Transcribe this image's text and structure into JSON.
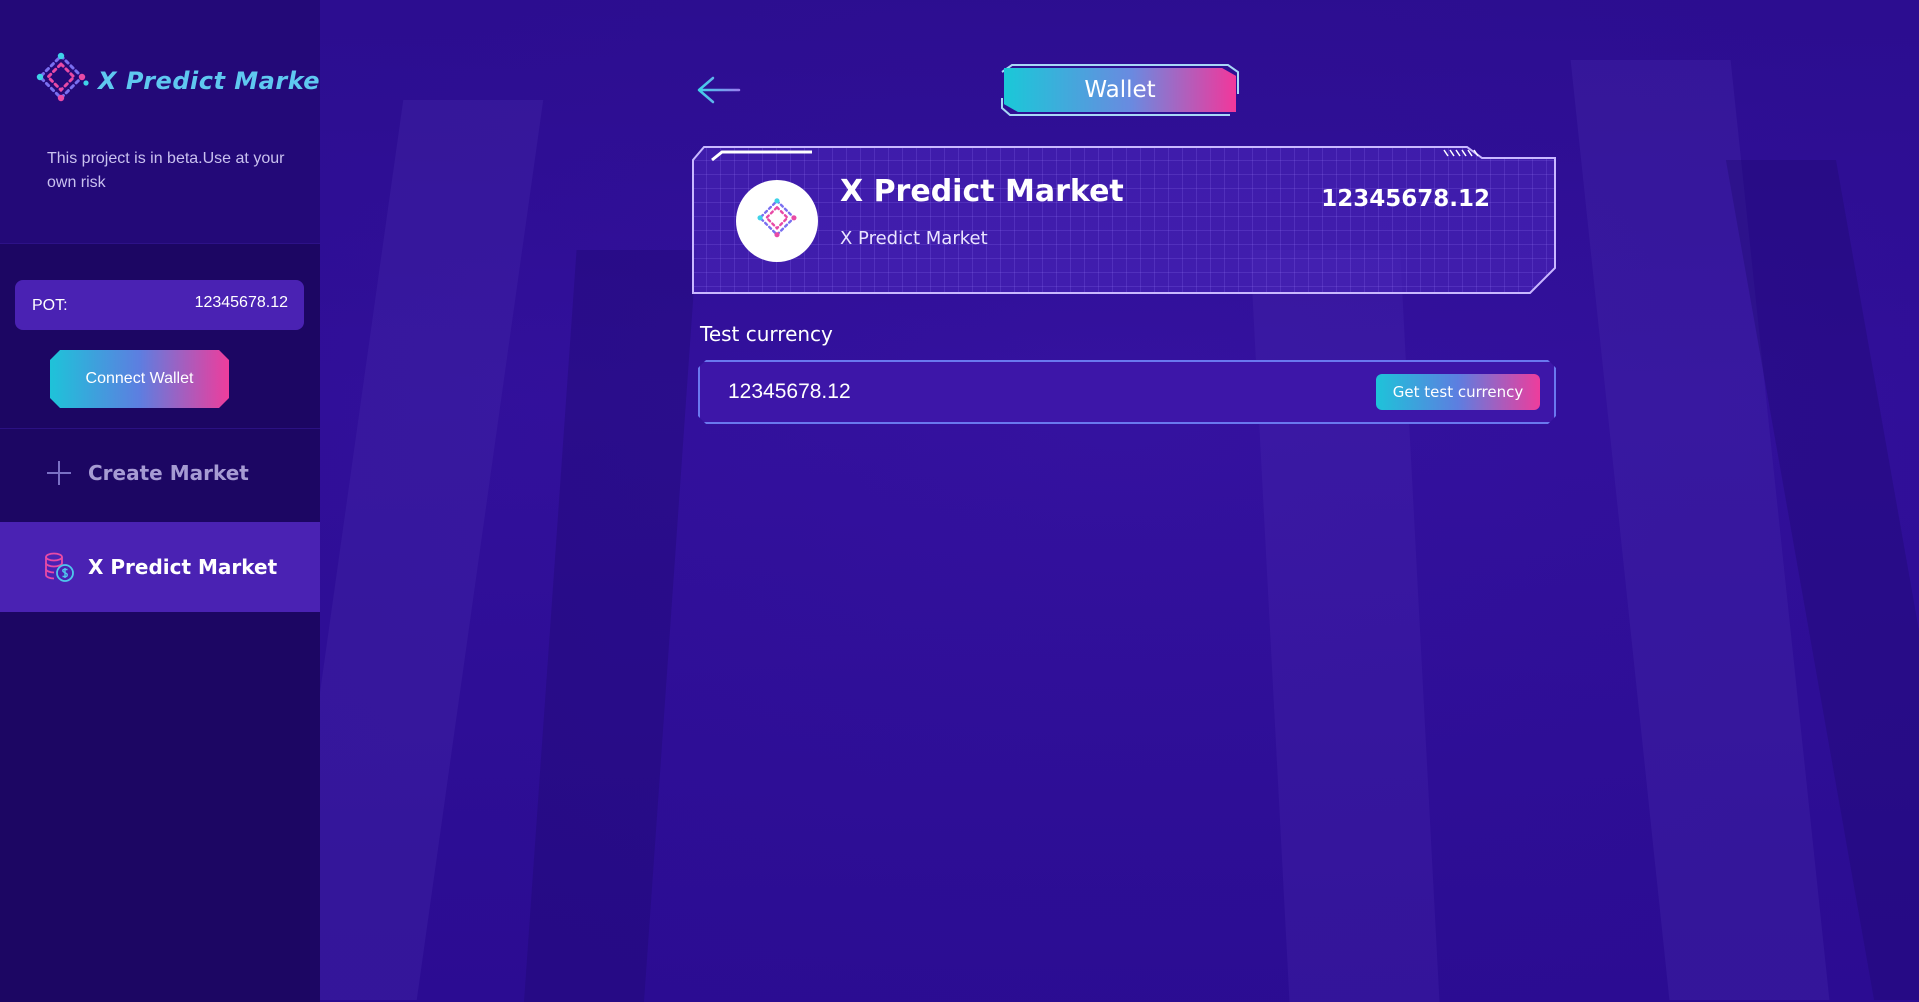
{
  "brand": {
    "name": "X Predict Market",
    "beta_note": "This project is in beta.Use at your own risk"
  },
  "sidebar": {
    "pot_label": "POT:",
    "pot_value": "12345678.12",
    "connect_wallet_label": "Connect Wallet",
    "nav": [
      {
        "label": "Create Market",
        "icon": "plus-icon",
        "active": false
      },
      {
        "label": "X Predict Market",
        "icon": "coins-icon",
        "active": true
      }
    ]
  },
  "page": {
    "title": "Wallet",
    "back_icon": "arrow-left-icon"
  },
  "wallet_card": {
    "name": "X Predict Market",
    "subtitle": "X Predict Market",
    "balance": "12345678.12"
  },
  "test_currency": {
    "label": "Test currency",
    "value": "12345678.12",
    "button_label": "Get test currency"
  },
  "colors": {
    "sidebar_bg": "#1c0663",
    "sidebar_top_bg": "#230978",
    "main_bg": "#2e0f92",
    "accent_cyan": "#1ec3d9",
    "accent_pink": "#ee3d9c",
    "active_nav_bg": "#4a22b3"
  }
}
